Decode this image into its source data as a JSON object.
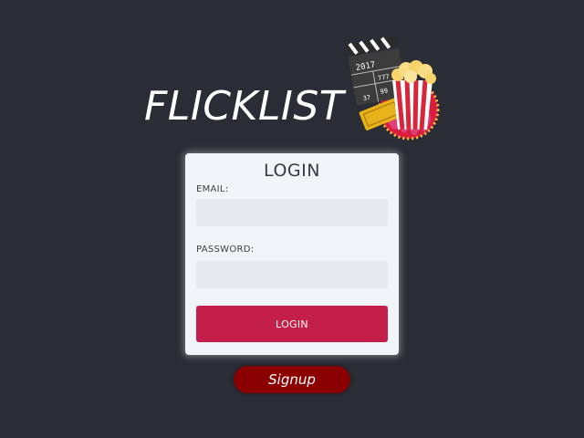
{
  "brand": {
    "name": "FLICKLIST",
    "logo_icon": "clapperboard-popcorn-ticket-icon",
    "logo_text": [
      "2017",
      "777",
      "99",
      "37"
    ]
  },
  "login_card": {
    "title": "LOGIN",
    "email_label": "EMAIL:",
    "email_value": "",
    "password_label": "PASSWORD:",
    "password_value": "",
    "submit_label": "LOGIN"
  },
  "signup": {
    "label": "Signup"
  },
  "colors": {
    "background": "#2a2d35",
    "card": "#f2f5f7",
    "input": "#e6eaed",
    "login_button": "#c41f4a",
    "signup_button": "#8a0000"
  }
}
